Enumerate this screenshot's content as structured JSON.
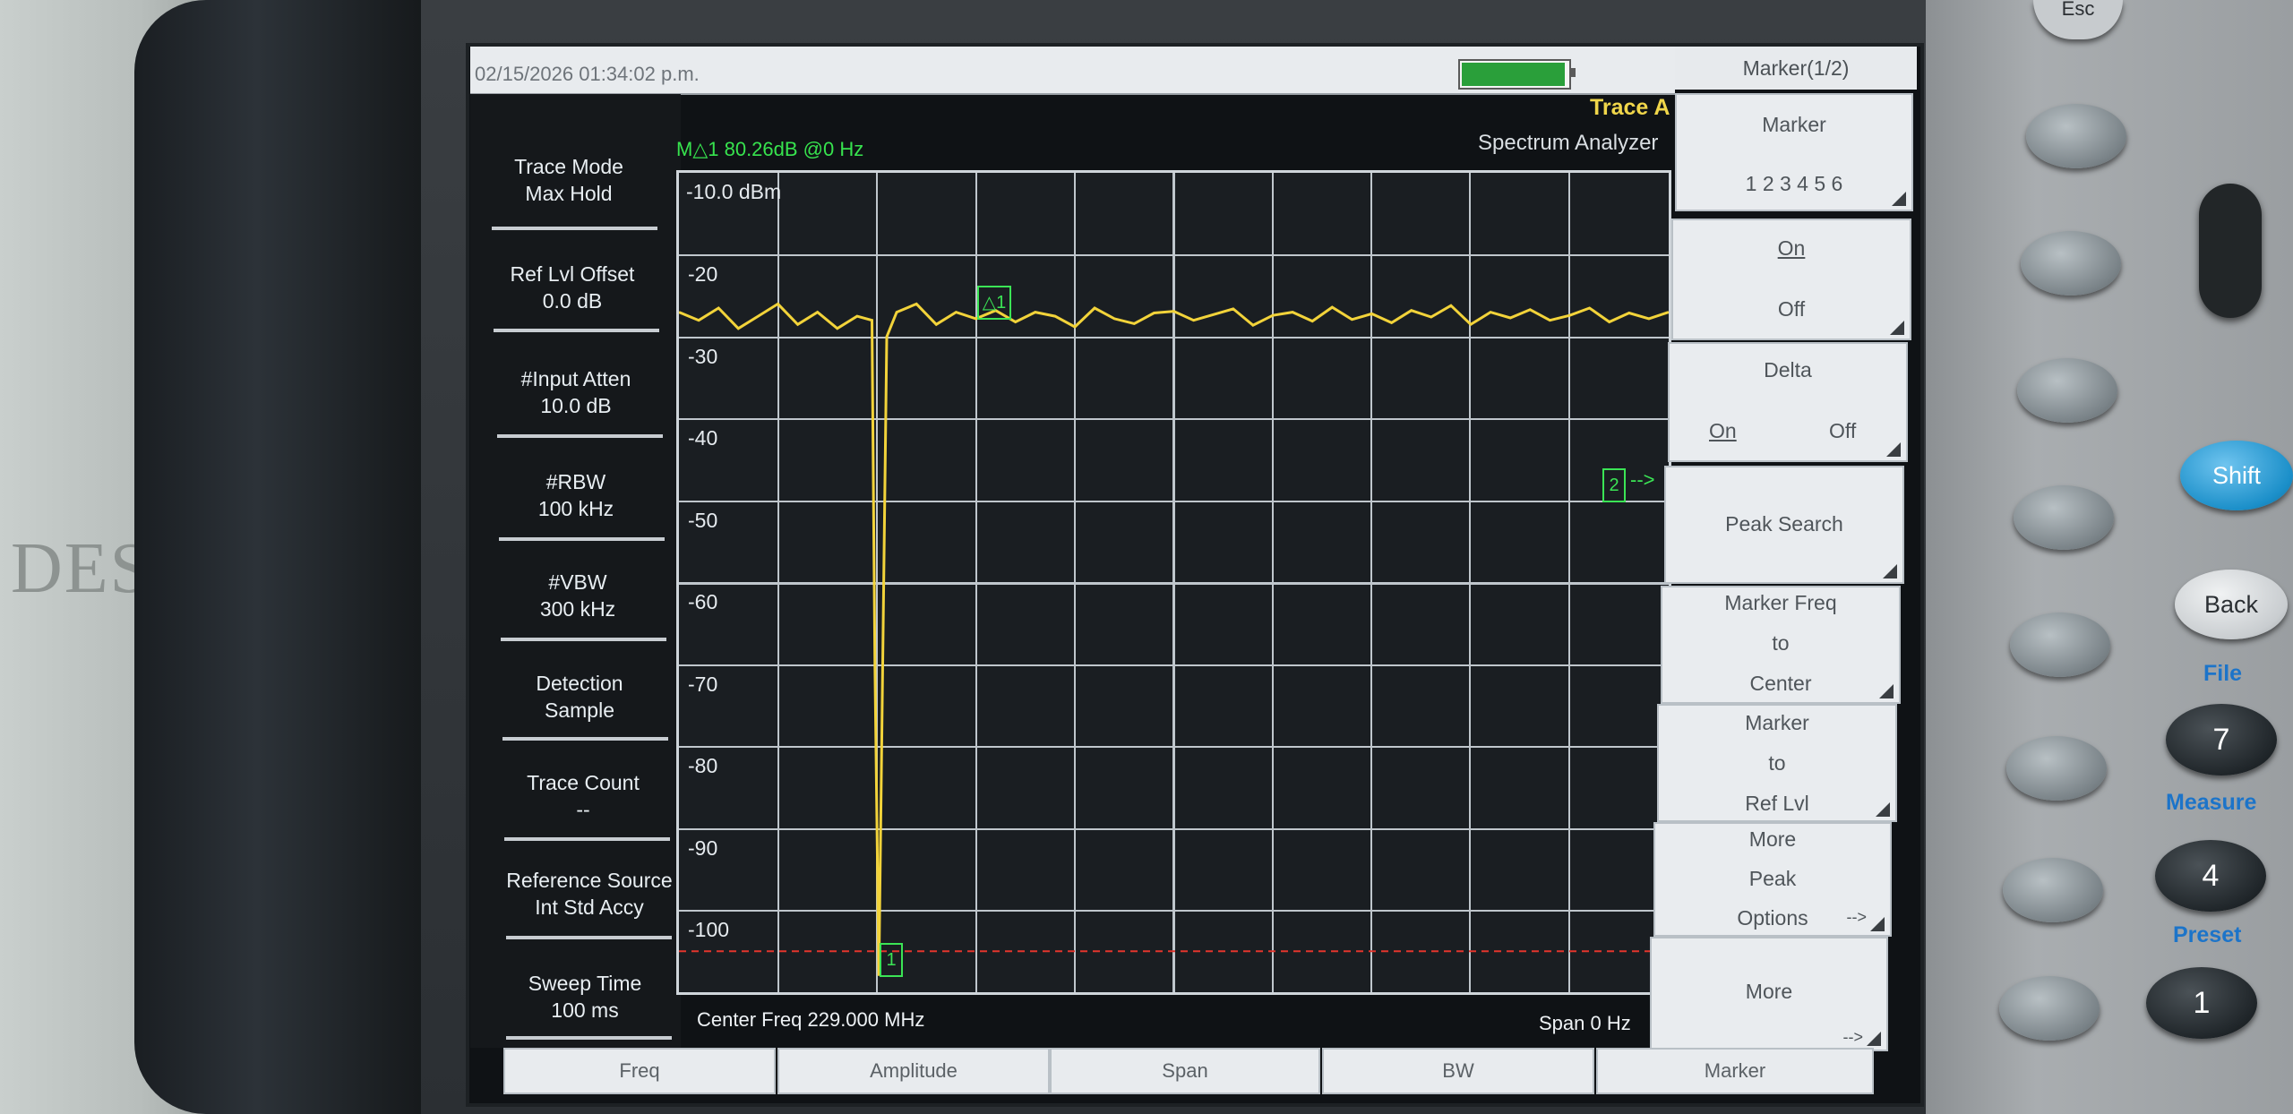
{
  "status_bar": {
    "datetime": "02/15/2026 01:34:02 p.m."
  },
  "left_panel": [
    {
      "title": "Trace Mode",
      "value": "Max Hold"
    },
    {
      "title": "Ref Lvl Offset",
      "value": "0.0 dB"
    },
    {
      "title": "#Input Atten",
      "value": "10.0 dB"
    },
    {
      "title": "#RBW",
      "value": "100 kHz"
    },
    {
      "title": "#VBW",
      "value": "300 kHz"
    },
    {
      "title": "Detection",
      "value": "Sample"
    },
    {
      "title": "Trace Count",
      "value": "--"
    },
    {
      "title": "Reference Source",
      "value": "Int Std Accy"
    },
    {
      "title": "Sweep Time",
      "value": "100 ms"
    }
  ],
  "plot": {
    "trace_label": "Trace A",
    "mode_label": "Spectrum Analyzer",
    "marker_readout": "M△1 80.26dB @0 Hz",
    "y_labels": [
      "-10.0 dBm",
      "-20",
      "-30",
      "-40",
      "-50",
      "-60",
      "-70",
      "-80",
      "-90",
      "-100"
    ],
    "center_freq": "Center Freq 229.000 MHz",
    "span": "Span 0 Hz",
    "markers": {
      "delta": "△1",
      "m1": "1",
      "m2": "2",
      "m2_arrow": "-->"
    }
  },
  "chart_data": {
    "type": "line",
    "x_unit": "time (zero span)",
    "xlim": [
      0,
      100
    ],
    "ylim": [
      -110,
      -10
    ],
    "series": [
      {
        "x": [
          0,
          2,
          4,
          6,
          8,
          10,
          12,
          14,
          16,
          18,
          19.5,
          19.8,
          20.2,
          21,
          22,
          24,
          26,
          28,
          30,
          32,
          34,
          36,
          38,
          40,
          42,
          44,
          46,
          48,
          50,
          52,
          54,
          56,
          58,
          60,
          62,
          64,
          66,
          68,
          70,
          72,
          74,
          76,
          78,
          80,
          82,
          84,
          86,
          88,
          90,
          92,
          94,
          96,
          98,
          100
        ],
        "y": [
          -27,
          -28,
          -26.5,
          -29,
          -27.5,
          -26,
          -28.5,
          -27,
          -29,
          -27.5,
          -28,
          -70,
          -108,
          -30,
          -27,
          -26,
          -28.5,
          -27,
          -27.8,
          -26.8,
          -28.2,
          -27,
          -27.5,
          -28.8,
          -26.5,
          -27.8,
          -28.4,
          -27.1,
          -26.9,
          -28,
          -27.3,
          -26.6,
          -28.6,
          -27.4,
          -27,
          -28.1,
          -26.4,
          -27.9,
          -27.2,
          -28.3,
          -26.8,
          -27.6,
          -26.2,
          -28.5,
          -27,
          -27.7,
          -26.7,
          -28,
          -27.4,
          -26.5,
          -28.2,
          -27.1,
          -27.8,
          -27
        ]
      }
    ],
    "reference_line_dbm": -105,
    "grid": true
  },
  "menu": {
    "header": "Marker(1/2)",
    "keys": [
      {
        "line1": "Marker",
        "line2": "1 2 3 4 5 6"
      },
      {
        "line1": "On",
        "line2": "Off"
      },
      {
        "line1": "Delta",
        "line2a": "On",
        "line2b": "Off"
      },
      {
        "line1": "Peak Search"
      },
      {
        "line1": "Marker Freq",
        "line2": "to",
        "line3": "Center"
      },
      {
        "line1": "Marker",
        "line2": "to",
        "line3": "Ref Lvl"
      },
      {
        "line1": "More",
        "line2": "Peak",
        "line3": "Options",
        "arrow": "-->"
      },
      {
        "line1": "More",
        "arrow": "-->"
      }
    ]
  },
  "tabs": [
    "Freq",
    "Amplitude",
    "Span",
    "BW",
    "Marker"
  ],
  "hardware": {
    "shift": "Shift",
    "back": "Back",
    "file": "File",
    "measure": "Measure",
    "preset": "Preset",
    "key7": "7",
    "key4": "4",
    "key1": "1",
    "esc": "Esc"
  },
  "background_text": "DES",
  "colors": {
    "trace": "#f2d33a",
    "marker": "#3be455",
    "grid": "#bfc6cc",
    "ref_line": "#e3352d",
    "accent_key": "#1b8fc9"
  }
}
